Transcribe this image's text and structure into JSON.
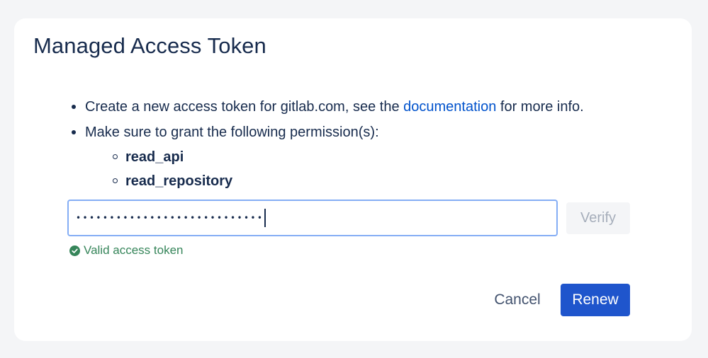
{
  "dialog": {
    "title": "Managed Access Token"
  },
  "instructions": {
    "line1_prefix": "Create a new access token for gitlab.com, see the ",
    "line1_link": "documentation",
    "line1_suffix": " for more info.",
    "line2": "Make sure to grant the following permission(s):",
    "permissions": [
      "read_api",
      "read_repository"
    ]
  },
  "token_field": {
    "value": "••••••••••••••••••••••••••••"
  },
  "verify_label": "Verify",
  "status": {
    "text": "Valid access token",
    "icon": "check-circle-icon",
    "color": "#36855a"
  },
  "footer": {
    "cancel_label": "Cancel",
    "renew_label": "Renew"
  },
  "colors": {
    "primary": "#1f55cc",
    "link": "#0052cc",
    "success": "#36855a",
    "input_focus_border": "#85aef5"
  }
}
